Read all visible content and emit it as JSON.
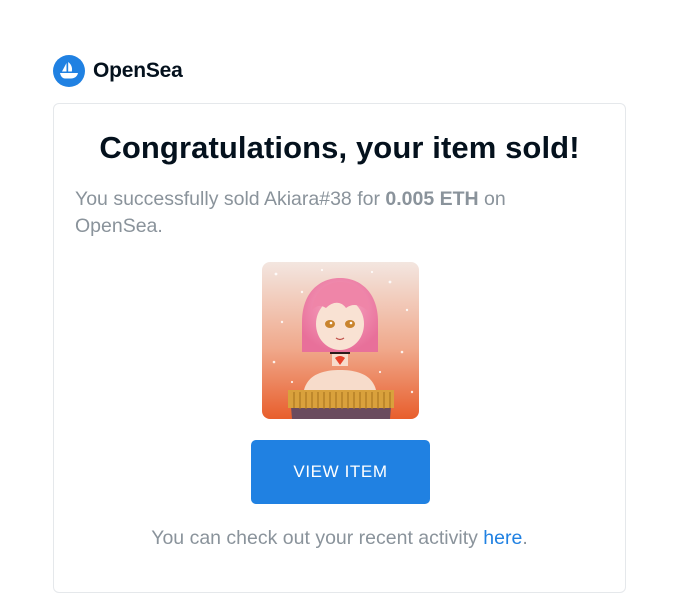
{
  "brand": {
    "name": "OpenSea",
    "logo_icon": "opensea-boat-icon",
    "color": "#2081e2"
  },
  "email": {
    "title": "Congratulations, your item sold!",
    "message": {
      "prefix": "You successfully sold Akiara#38 for ",
      "amount": "0.005 ETH",
      "suffix": " on OpenSea."
    },
    "item_image": "anime-girl-pink-hair-nft-image",
    "button_label": "VIEW ITEM",
    "footer": {
      "prefix": "You can check out your recent activity ",
      "link_label": "here",
      "suffix": "."
    }
  }
}
